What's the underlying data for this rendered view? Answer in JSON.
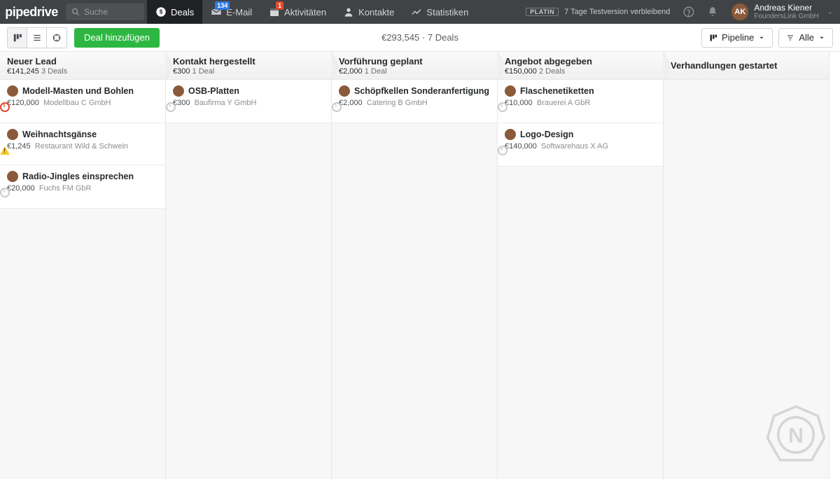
{
  "brand": "pipedrive",
  "search_placeholder": "Suche",
  "nav": {
    "deals": "Deals",
    "email": "E-Mail",
    "email_badge": "134",
    "activities": "Aktivitäten",
    "activities_badge": "1",
    "contacts": "Kontakte",
    "stats": "Statistiken"
  },
  "trial": {
    "badge": "PLATIN",
    "text": "7 Tage Testversion verbleibend"
  },
  "user": {
    "name": "Andreas Kiener",
    "org": "FoundersLink GmbH",
    "initials": "AK"
  },
  "toolbar": {
    "add_deal": "Deal hinzufügen",
    "summary_amount": "€293,545",
    "summary_sep": " · ",
    "summary_count": "7 Deals",
    "pipeline_label": "Pipeline",
    "filter_label": "Alle"
  },
  "columns": [
    {
      "title": "Neuer Lead",
      "amount": "€141,245",
      "count": "3 Deals",
      "cards": [
        {
          "title": "Modell-Masten und Bohlen",
          "amount": "€120,000",
          "org": "Modellbau C GmbH",
          "status": "red"
        },
        {
          "title": "Weihnachtsgänse",
          "amount": "€1,245",
          "org": "Restaurant Wild & Schwein",
          "status": "warn"
        },
        {
          "title": "Radio-Jingles einsprechen",
          "amount": "€20,000",
          "org": "Fuchs FM GbR",
          "status": "grey"
        }
      ]
    },
    {
      "title": "Kontakt hergestellt",
      "amount": "€300",
      "count": "1 Deal",
      "cards": [
        {
          "title": "OSB-Platten",
          "amount": "€300",
          "org": "Baufirma Y GmbH",
          "status": "grey"
        }
      ]
    },
    {
      "title": "Vorführung geplant",
      "amount": "€2,000",
      "count": "1 Deal",
      "cards": [
        {
          "title": "Schöpfkellen Sonderanfertigung",
          "amount": "€2,000",
          "org": "Catering B GmbH",
          "status": "grey"
        }
      ]
    },
    {
      "title": "Angebot abgegeben",
      "amount": "€150,000",
      "count": "2 Deals",
      "cards": [
        {
          "title": "Flaschenetiketten",
          "amount": "€10,000",
          "org": "Brauerei A GbR",
          "status": "grey"
        },
        {
          "title": "Logo-Design",
          "amount": "€140,000",
          "org": "Softwarehaus X AG",
          "status": "grey"
        }
      ]
    },
    {
      "title": "Verhandlungen gestartet",
      "amount": "",
      "count": "",
      "cards": []
    }
  ]
}
